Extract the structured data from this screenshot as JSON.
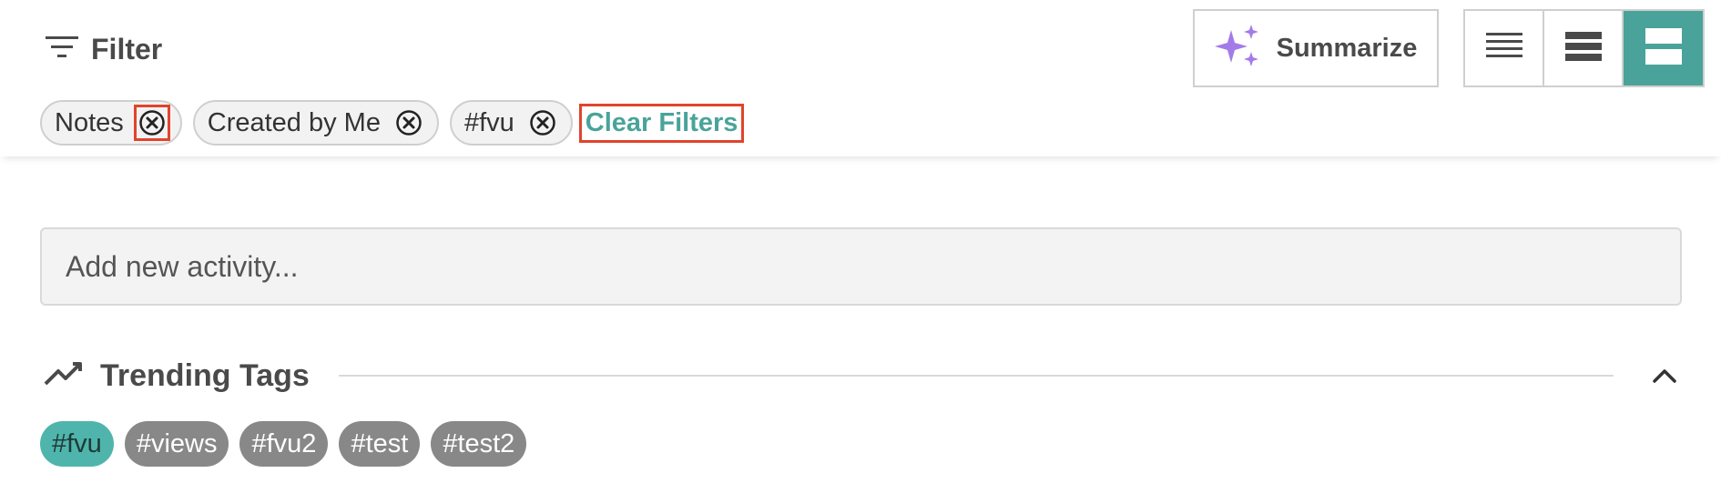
{
  "header": {
    "filter_label": "Filter",
    "summarize_label": "Summarize",
    "view_modes": [
      {
        "name": "compact-list-view",
        "active": false
      },
      {
        "name": "list-view",
        "active": false
      },
      {
        "name": "card-view",
        "active": true
      }
    ]
  },
  "filters": {
    "chips": [
      {
        "label": "Notes"
      },
      {
        "label": "Created by Me"
      },
      {
        "label": "#fvu"
      }
    ],
    "clear_label": "Clear Filters"
  },
  "activity": {
    "placeholder": "Add new activity..."
  },
  "trending": {
    "title": "Trending Tags",
    "tags": [
      {
        "label": "#fvu",
        "active": true
      },
      {
        "label": "#views",
        "active": false
      },
      {
        "label": "#fvu2",
        "active": false
      },
      {
        "label": "#test",
        "active": false
      },
      {
        "label": "#test2",
        "active": false
      }
    ]
  },
  "colors": {
    "accent": "#4aa39a",
    "active_tag": "#4fb5ac",
    "inactive_tag": "#888888",
    "sparkle": "#a37be8",
    "highlight_outline": "#e0442c"
  }
}
